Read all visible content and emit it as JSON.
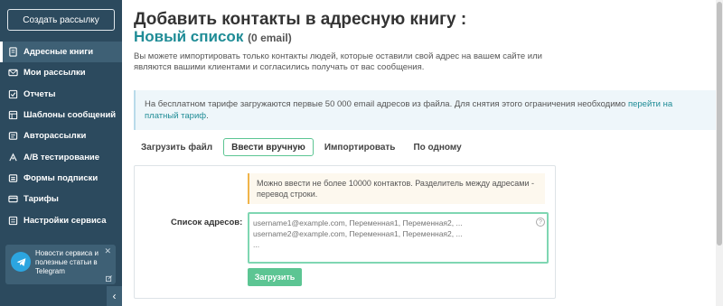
{
  "sidebar": {
    "create_button": "Создать рассылку",
    "items": [
      {
        "label": "Адресные книги",
        "icon": "book-icon"
      },
      {
        "label": "Мои рассылки",
        "icon": "mailings-icon"
      },
      {
        "label": "Отчеты",
        "icon": "reports-icon"
      },
      {
        "label": "Шаблоны сообщений",
        "icon": "templates-icon"
      },
      {
        "label": "Авторассылки",
        "icon": "autoresponder-icon"
      },
      {
        "label": "A/B тестирование",
        "icon": "ab-test-icon"
      },
      {
        "label": "Формы подписки",
        "icon": "forms-icon"
      },
      {
        "label": "Тарифы",
        "icon": "tariffs-icon"
      },
      {
        "label": "Настройки сервиса",
        "icon": "settings-icon"
      }
    ],
    "telegram": {
      "text": "Новости сервиса и полезные статьи в Telegram",
      "close": "✕"
    },
    "collapse": "‹"
  },
  "main": {
    "title": "Добавить контакты в адресную книгу :",
    "list_name": "Новый список",
    "list_count": "(0 email)",
    "description": "Вы можете импортировать только контакты людей, которые оставили свой адрес на вашем сайте или являются вашими клиентами и согласились получать от вас сообщения.",
    "notice_text": "На бесплатном тарифе загружаются первые 50 000 email адресов из файла. Для снятия этого ограничения необходимо ",
    "notice_link": "перейти на платный тариф",
    "notice_end": ".",
    "tabs": [
      "Загрузить файл",
      "Ввести вручную",
      "Импортировать",
      "По одному"
    ],
    "active_tab": 1,
    "hint": "Можно ввести не более 10000 контактов. Разделитель между адресами - перевод строки.",
    "field_label": "Список адресов:",
    "placeholder": "username1@example.com, Переменная1, Переменная2, ...\nusername2@example.com, Переменная1, Переменная2, ...\n...",
    "help": "?",
    "upload_button": "Загрузить"
  },
  "colors": {
    "sidebar": "#2c4a5e",
    "accent": "#1f8c96",
    "green": "#5cc593",
    "telegram": "#2ca5e0"
  }
}
